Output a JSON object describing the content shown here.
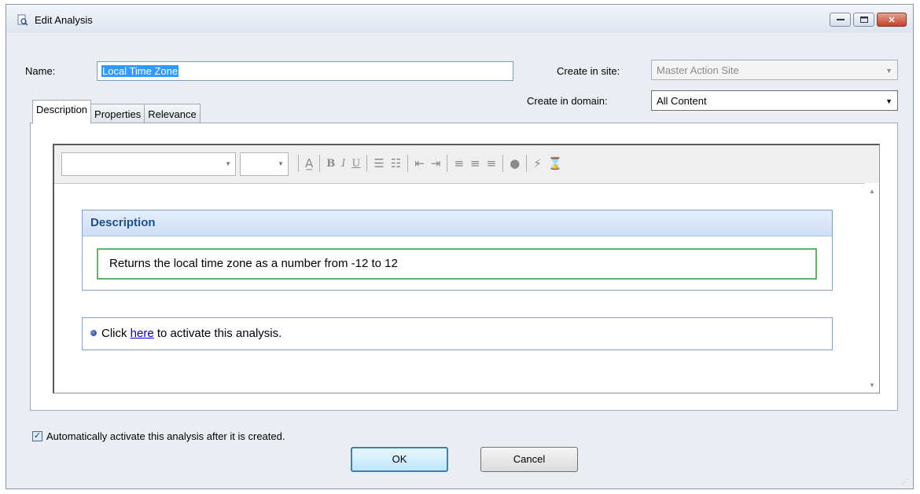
{
  "window": {
    "title": "Edit Analysis",
    "minimize": "–",
    "maximize": "□",
    "close": "✕"
  },
  "form": {
    "name_label": "Name:",
    "name_value": "Local Time Zone",
    "site_label": "Create in site:",
    "site_value": "Master Action Site",
    "domain_label": "Create in domain:",
    "domain_value": "All Content"
  },
  "tabs": [
    {
      "label": "Description",
      "active": true
    },
    {
      "label": "Properties",
      "active": false
    },
    {
      "label": "Relevance",
      "active": false
    }
  ],
  "toolbar": {
    "font_name": "",
    "font_size": "",
    "icons": [
      "font-color-icon",
      "bold-icon",
      "italic-icon",
      "underline-icon",
      "numbered-list-icon",
      "bulleted-list-icon",
      "outdent-icon",
      "indent-icon",
      "align-left-icon",
      "align-center-icon",
      "align-right-icon",
      "link-icon",
      "wand-icon",
      "image-icon"
    ]
  },
  "editor": {
    "desc_title": "Description",
    "desc_text": "Returns the local time zone as a number from -12 to 12",
    "click_prefix": "Click ",
    "click_link": "here",
    "click_suffix": " to activate this analysis."
  },
  "footer": {
    "auto_activate_label": "Automatically activate this analysis after it is created.",
    "auto_activate_checked": true,
    "ok_label": "OK",
    "cancel_label": "Cancel"
  }
}
